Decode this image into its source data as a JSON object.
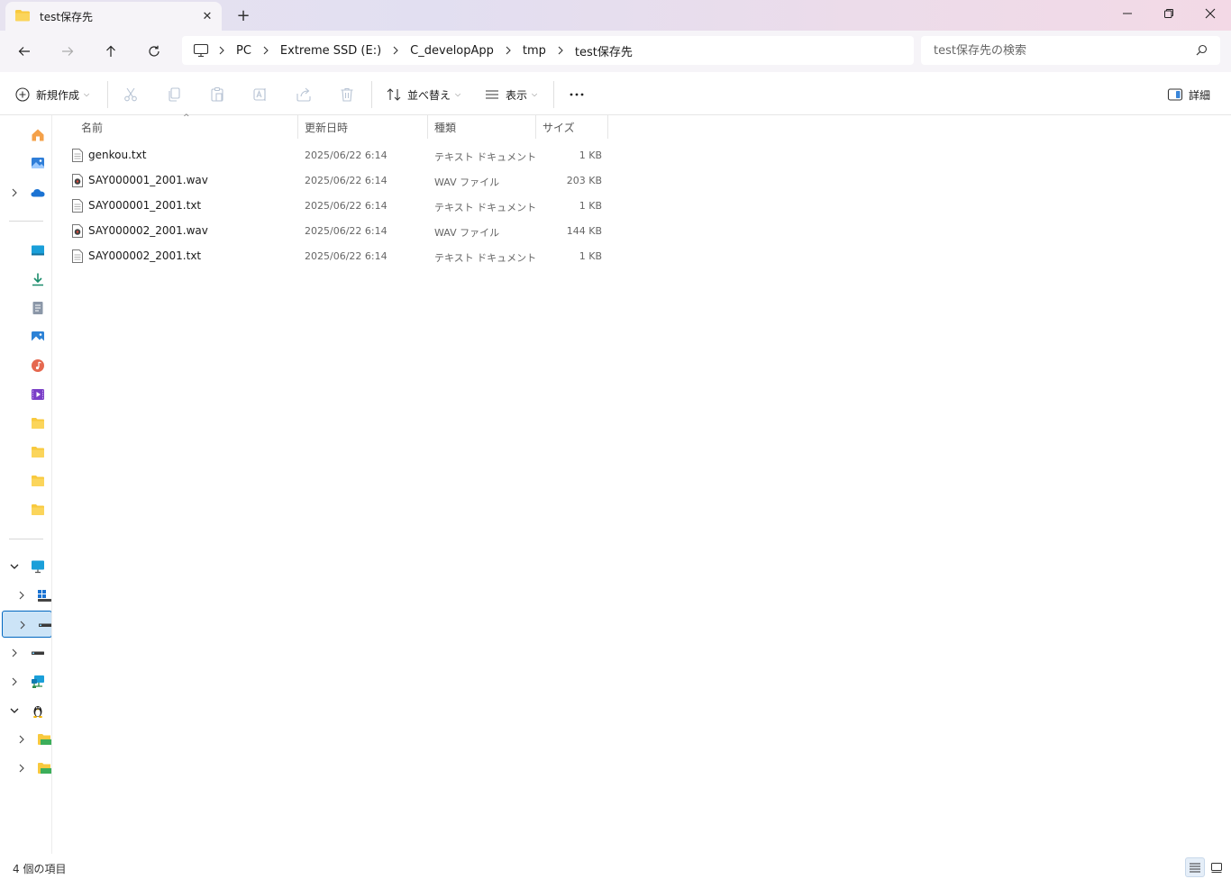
{
  "tab": {
    "title": "test保存先"
  },
  "breadcrumbs": [
    "PC",
    "Extreme SSD (E:)",
    "C_developApp",
    "tmp",
    "test保存先"
  ],
  "search": {
    "placeholder": "test保存先の検索"
  },
  "toolbar": {
    "new_label": "新規作成",
    "sort_label": "並べ替え",
    "view_label": "表示",
    "details_label": "詳細"
  },
  "columns": {
    "name": "名前",
    "modified": "更新日時",
    "type": "種類",
    "size": "サイズ"
  },
  "files": [
    {
      "name": "genkou.txt",
      "modified": "2025/06/22 6:14",
      "type": "テキスト ドキュメント",
      "size": "1 KB",
      "icon": "text-file-icon"
    },
    {
      "name": "SAY000001_2001.wav",
      "modified": "2025/06/22 6:14",
      "type": "WAV ファイル",
      "size": "203 KB",
      "icon": "audio-file-icon"
    },
    {
      "name": "SAY000001_2001.txt",
      "modified": "2025/06/22 6:14",
      "type": "テキスト ドキュメント",
      "size": "1 KB",
      "icon": "text-file-icon"
    },
    {
      "name": "SAY000002_2001.wav",
      "modified": "2025/06/22 6:14",
      "type": "WAV ファイル",
      "size": "144 KB",
      "icon": "audio-file-icon"
    },
    {
      "name": "SAY000002_2001.txt",
      "modified": "2025/06/22 6:14",
      "type": "テキスト ドキュメント",
      "size": "1 KB",
      "icon": "text-file-icon"
    }
  ],
  "status": {
    "item_count": "4 個の項目"
  },
  "colors": {
    "accent": "#0067c0",
    "folder": "#f8c93e",
    "titlebar_left": "#e7e3f0",
    "titlebar_right": "#f3d9e6"
  }
}
